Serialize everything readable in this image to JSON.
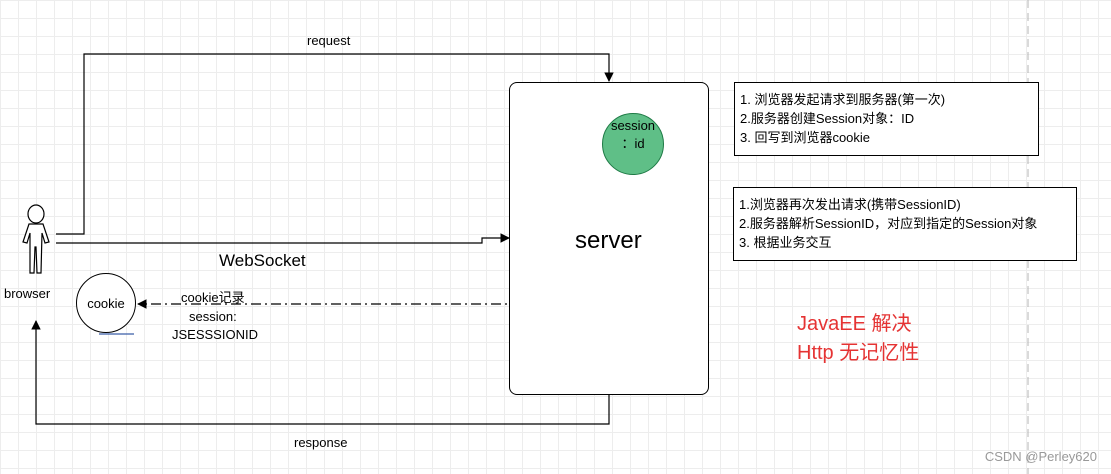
{
  "labels": {
    "request": "request",
    "response": "response",
    "websocket": "WebSocket",
    "browser": "browser",
    "cookie": "cookie",
    "cookie_note_line1": "cookie记录",
    "cookie_note_line2": "session:",
    "cookie_note_line3": "JSESSSIONID",
    "server": "server",
    "session_line1": "session",
    "session_line2": "：id"
  },
  "note_first": {
    "lines": [
      "1. 浏览器发起请求到服务器(第一次)",
      "2.服务器创建Session对象：ID",
      "3. 回写到浏览器cookie"
    ]
  },
  "note_second": {
    "lines": [
      "1.浏览器再次发出请求(携带SessionID)",
      "2.服务器解析SessionID，对应到指定的Session对象",
      "3. 根据业务交互"
    ]
  },
  "javaee_line1": "JavaEE 解决",
  "javaee_line2": "Http 无记忆性",
  "watermark": "CSDN @Perley620",
  "colors": {
    "session_fill": "#5fbf87",
    "highlight_text": "#e53333"
  }
}
